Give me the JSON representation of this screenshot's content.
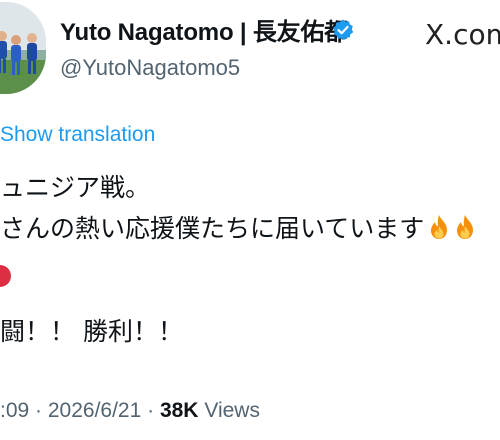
{
  "author": {
    "display_name": "Yuto Nagatomo | 長友佑都",
    "handle": "@YutoNagatomo5"
  },
  "brand": "X.com",
  "translate_link": "Show translation",
  "tweet": {
    "line1": "ュニジア戦。",
    "line2": "さんの熱い応援僕たちに届いています",
    "line4": "闘！！ 勝利！！"
  },
  "meta": {
    "time_date": ":09 · 2026/6/21 · ",
    "views_count": "38K",
    "views_label": " Views"
  },
  "colors": {
    "link": "#1d9bf0",
    "secondary_text": "#536471",
    "verified_badge": "#1d9bf0"
  },
  "icons": [
    "verified-badge-icon",
    "fire-emoji-icon",
    "red-circle-emoji-icon"
  ]
}
